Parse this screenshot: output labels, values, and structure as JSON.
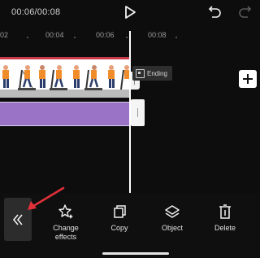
{
  "header": {
    "timecode": "00:06/00:08"
  },
  "ruler": {
    "ticks": [
      "02",
      "00:04",
      "00:06",
      "00:08"
    ]
  },
  "timeline": {
    "ending_label": "Ending"
  },
  "toolbar": {
    "items": [
      {
        "label": "Change\neffects",
        "icon": "star-effects-icon"
      },
      {
        "label": "Copy",
        "icon": "copy-icon"
      },
      {
        "label": "Object",
        "icon": "layers-icon"
      },
      {
        "label": "Delete",
        "icon": "trash-icon"
      }
    ]
  },
  "colors": {
    "background": "#0d0d0d",
    "purple_track": "#9a73c7",
    "video_top_line": "#c83a4a",
    "annotation_arrow": "#e3313a"
  }
}
